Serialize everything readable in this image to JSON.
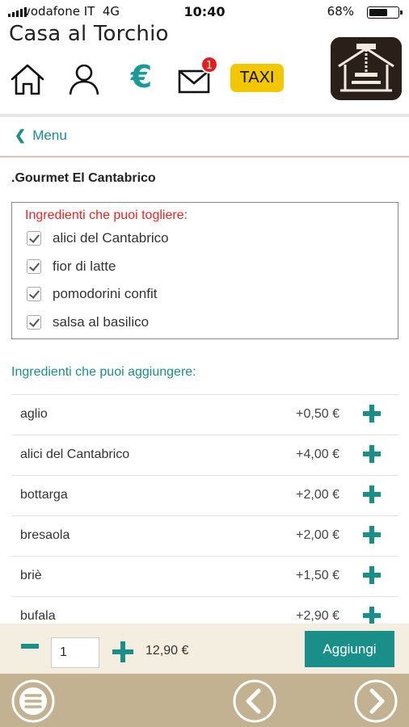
{
  "status_bar": {
    "carrier": "vodafone IT",
    "network": "4G",
    "time": "10:40",
    "battery": "68%",
    "battery_level": 0.68
  },
  "header": {
    "title": "Casa al Torchio",
    "euro_symbol": "€",
    "mail_badge": "1",
    "taxi_label": "TAXI"
  },
  "nav": {
    "back_label": "Menu"
  },
  "dish": {
    "name": ".Gourmet El Cantabrico"
  },
  "removable": {
    "title": "Ingredienti che puoi togliere:",
    "items": [
      "alici del Cantabrico",
      "fior di latte",
      "pomodorini confit",
      "salsa al basilico"
    ]
  },
  "addable": {
    "title": "Ingredienti che puoi aggiungere:",
    "items": [
      {
        "name": "aglio",
        "price": "+0,50 €"
      },
      {
        "name": "alici del Cantabrico",
        "price": "+4,00 €"
      },
      {
        "name": "bottarga",
        "price": "+2,00 €"
      },
      {
        "name": "bresaola",
        "price": "+2,00 €"
      },
      {
        "name": "briè",
        "price": "+1,50 €"
      },
      {
        "name": "bufala",
        "price": "+2,90 €"
      }
    ]
  },
  "order": {
    "quantity": "1",
    "total": "12,90 €",
    "add_button": "Aggiungi"
  },
  "colors": {
    "accent": "#1a8f8a",
    "alert": "#e22222",
    "taxi": "#f2c700",
    "addbar_bg": "#f4eee1",
    "navbar_bg": "#c2b291"
  }
}
